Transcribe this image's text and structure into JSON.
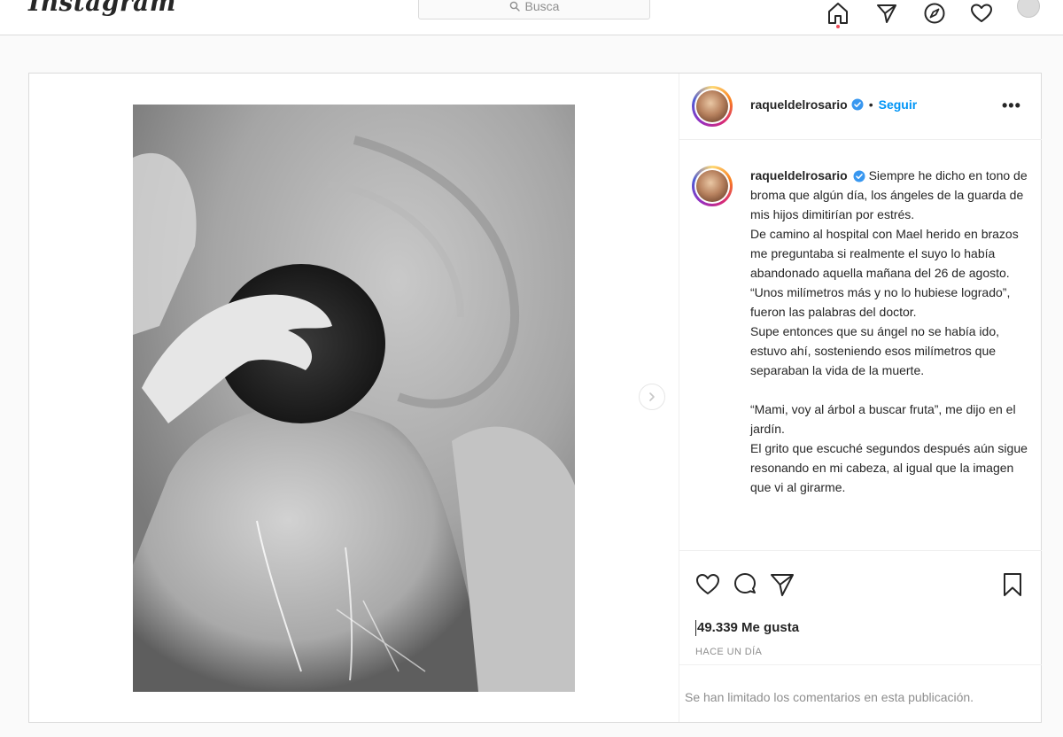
{
  "nav": {
    "logo": "Instagram",
    "search_placeholder": "Busca"
  },
  "post": {
    "username": "raqueldelrosario",
    "separator": "•",
    "follow_label": "Seguir",
    "more_label": "•••",
    "caption_lines": [
      "Siempre he dicho en tono de broma que algún día, los ángeles de la guarda de mis hijos dimitirían por estrés.",
      "De camino al hospital con Mael herido en brazos me preguntaba si realmente el suyo lo había abandonado aquella mañana del 26 de agosto.",
      "“Unos milímetros más y no lo hubiese logrado”, fueron las palabras del doctor.",
      "Supe entonces que su ángel no se había ido, estuvo ahí, sosteniendo esos milímetros que separaban la vida de la muerte.",
      "",
      "“Mami, voy al árbol a buscar fruta”, me dijo en el jardín.",
      "El grito que escuché segundos después aún sigue resonando en mi cabeza, al igual que la imagen que vi al girarme."
    ],
    "likes": "49.339 Me gusta",
    "timestamp": "HACE UN DÍA",
    "comments_notice": "Se han limitado los comentarios en esta publicación."
  },
  "colors": {
    "accent_blue": "#0095f6",
    "notification_red": "#ed4956",
    "border": "#dbdbdb",
    "muted_text": "#8e8e8e"
  },
  "icons": {
    "nav": [
      "home-icon",
      "direct-icon",
      "explore-icon",
      "activity-heart-icon",
      "profile-avatar"
    ],
    "post_actions": [
      "like-heart-icon",
      "comment-icon",
      "share-icon",
      "save-bookmark-icon"
    ],
    "media": [
      "chevron-right-icon"
    ],
    "verified": "verified-badge-icon"
  }
}
